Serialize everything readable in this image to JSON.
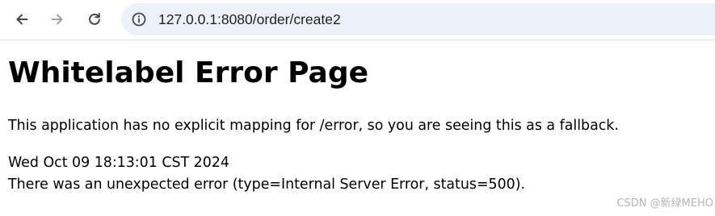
{
  "browser": {
    "url": "127.0.0.1:8080/order/create2",
    "icons": {
      "back": "arrow-left",
      "forward": "arrow-right",
      "reload": "reload",
      "site_info": "info-circle"
    },
    "address_bar_bg": "#edf2fa",
    "forward_disabled_color": "#a0a0a0"
  },
  "page": {
    "heading": "Whitelabel Error Page",
    "message": "This application has no explicit mapping for /error, so you are seeing this as a fallback.",
    "timestamp": "Wed Oct 09 18:13:01 CST 2024",
    "error_detail": "There was an unexpected error (type=Internal Server Error, status=500)."
  },
  "watermark": {
    "text": "CSDN @新绿MEHO"
  }
}
